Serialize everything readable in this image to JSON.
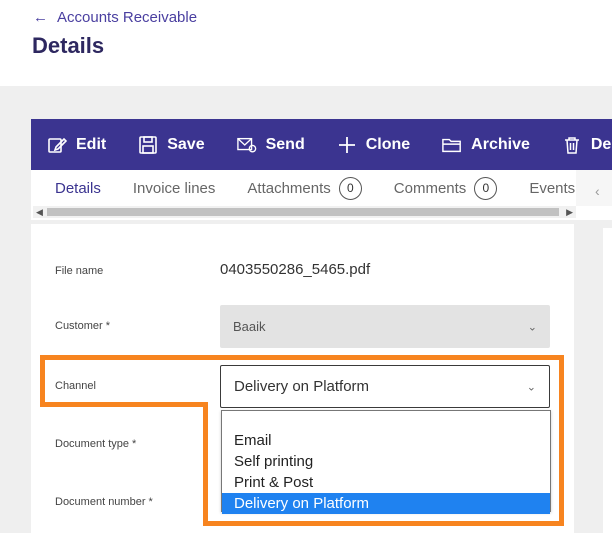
{
  "header": {
    "back_label": "Accounts Receivable",
    "title": "Details"
  },
  "toolbar": {
    "buttons": [
      {
        "label": "Edit",
        "icon": "edit-icon"
      },
      {
        "label": "Save",
        "icon": "save-icon"
      },
      {
        "label": "Send",
        "icon": "send-email-icon"
      },
      {
        "label": "Clone",
        "icon": "plus-icon"
      },
      {
        "label": "Archive",
        "icon": "folder-icon"
      },
      {
        "label": "Delete",
        "icon": "trash-icon"
      }
    ]
  },
  "tabs": [
    {
      "label": "Details",
      "active": true
    },
    {
      "label": "Invoice lines"
    },
    {
      "label": "Attachments",
      "count": "0"
    },
    {
      "label": "Comments",
      "count": "0"
    },
    {
      "label": "Events"
    }
  ],
  "form": {
    "file_name": {
      "label": "File name",
      "value": "0403550286_5465.pdf"
    },
    "customer": {
      "label": "Customer *",
      "value": "Baaik"
    },
    "channel": {
      "label": "Channel",
      "value": "Delivery on Platform",
      "options": [
        "Email",
        "Self printing",
        "Print & Post",
        "Delivery on Platform"
      ],
      "selected_index": 3
    },
    "document_type": {
      "label": "Document type *"
    },
    "document_number": {
      "label": "Document number *"
    }
  },
  "colors": {
    "toolbar_bg": "#3b3490",
    "title": "#2e2860",
    "highlight": "#f7841f",
    "selected_option": "#1f82f0"
  }
}
